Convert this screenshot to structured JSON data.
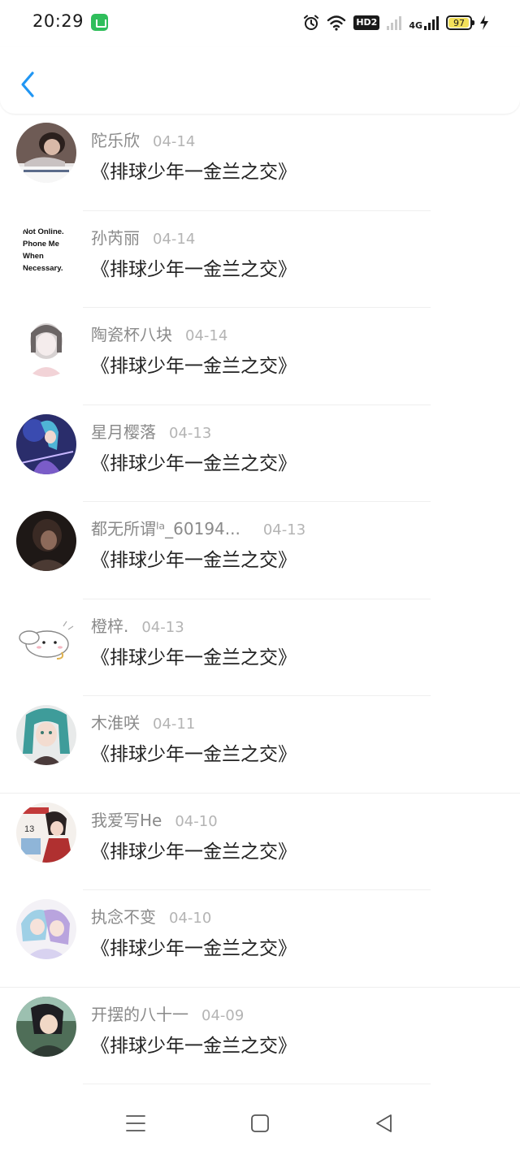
{
  "status_bar": {
    "time": "20:29",
    "hd": "HD2",
    "network": "4G",
    "battery": "97",
    "icons": [
      "wechat-app-icon",
      "alarm-icon",
      "wifi-icon",
      "signal-icon",
      "charging-icon"
    ]
  },
  "header": {
    "back_icon": "chevron-left-icon",
    "accent": "#2196f3"
  },
  "comments": [
    {
      "user": "陀乐欣",
      "date": "04-14",
      "text": "《排球少年一金兰之交》"
    },
    {
      "user": "孙芮丽",
      "date": "04-14",
      "text": "《排球少年一金兰之交》",
      "avatar_lines": [
        "Not Online.",
        "Phone Me",
        "When",
        "Necessary."
      ]
    },
    {
      "user": "陶瓷杯八块",
      "date": "04-14",
      "text": "《排球少年一金兰之交》"
    },
    {
      "user": "星月樱落",
      "date": "04-13",
      "text": "《排球少年一金兰之交》"
    },
    {
      "user": "都无所谓ˡᵃ_60194...",
      "date": "04-13",
      "text": "《排球少年一金兰之交》"
    },
    {
      "user": "橙梓.",
      "date": "04-13",
      "text": "《排球少年一金兰之交》"
    },
    {
      "user": "木淮咲",
      "date": "04-11",
      "text": "《排球少年一金兰之交》"
    },
    {
      "user": "我爱写He",
      "date": "04-10",
      "text": "《排球少年一金兰之交》"
    },
    {
      "user": "执念不变",
      "date": "04-10",
      "text": "《排球少年一金兰之交》"
    },
    {
      "user": "开摆的八十一",
      "date": "04-09",
      "text": "《排球少年一金兰之交》"
    }
  ],
  "nav_bar": {
    "icons": [
      "menu-icon",
      "home-icon",
      "back-triangle-icon"
    ]
  }
}
